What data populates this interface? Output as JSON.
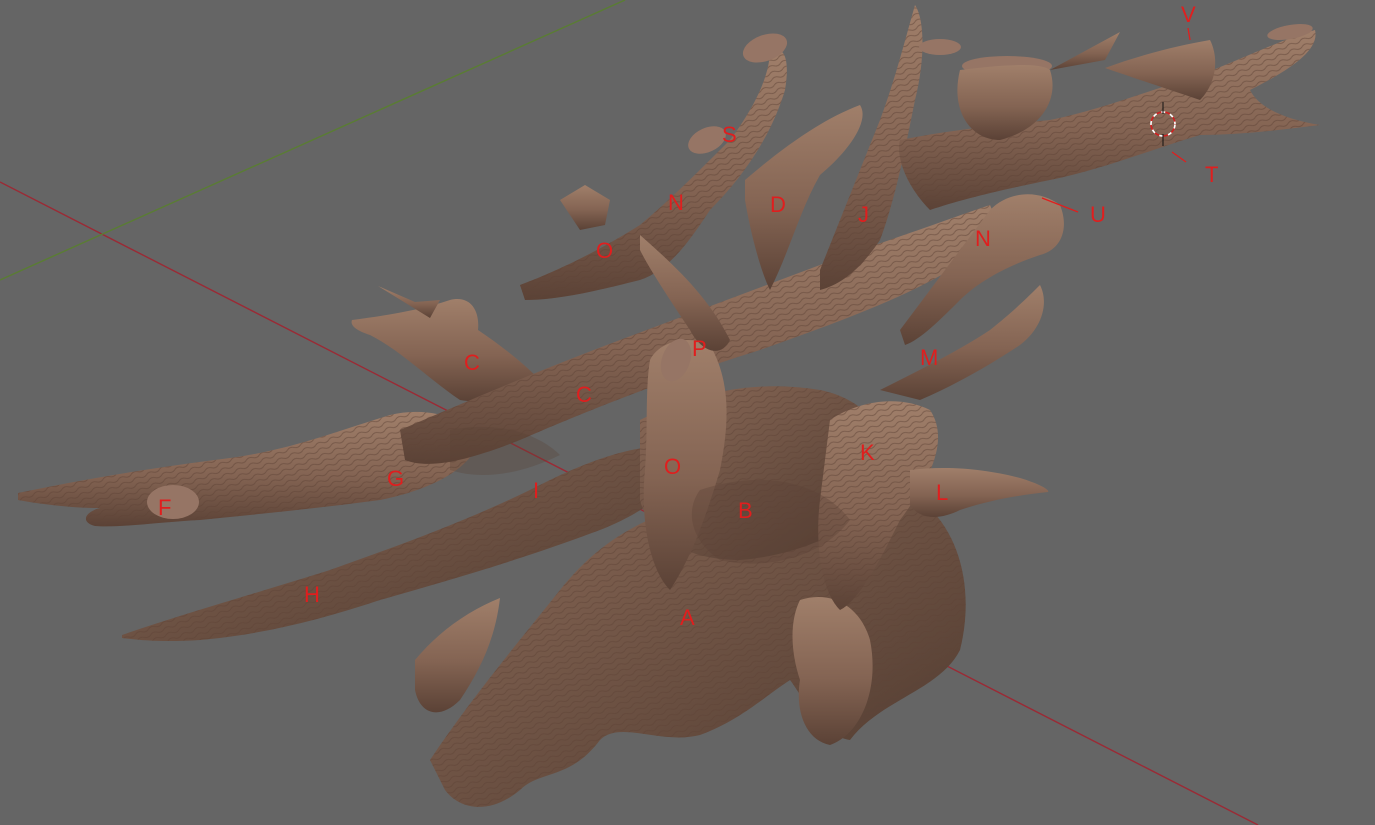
{
  "viewport": {
    "background": "#656565",
    "colors": {
      "x_axis": "#9b2a35",
      "y_axis": "#5a7d33",
      "mesh_base": "#846453",
      "mesh_shadow": "#5b4236",
      "mesh_light": "#a07f6a",
      "cut_face": "#967565",
      "annotation": "#e01e1e"
    },
    "cursor_icon": "3d-cursor-icon"
  },
  "labels": {
    "A": "A",
    "B": "B",
    "C1": "C",
    "C2": "C",
    "D": "D",
    "F": "F",
    "G": "G",
    "H": "H",
    "I": "I",
    "J": "J",
    "K": "K",
    "L": "L",
    "M": "M",
    "N1": "N",
    "N2": "N",
    "O1": "O",
    "O2": "O",
    "P": "P",
    "S": "S",
    "T": "T",
    "U": "U",
    "V": "V"
  }
}
